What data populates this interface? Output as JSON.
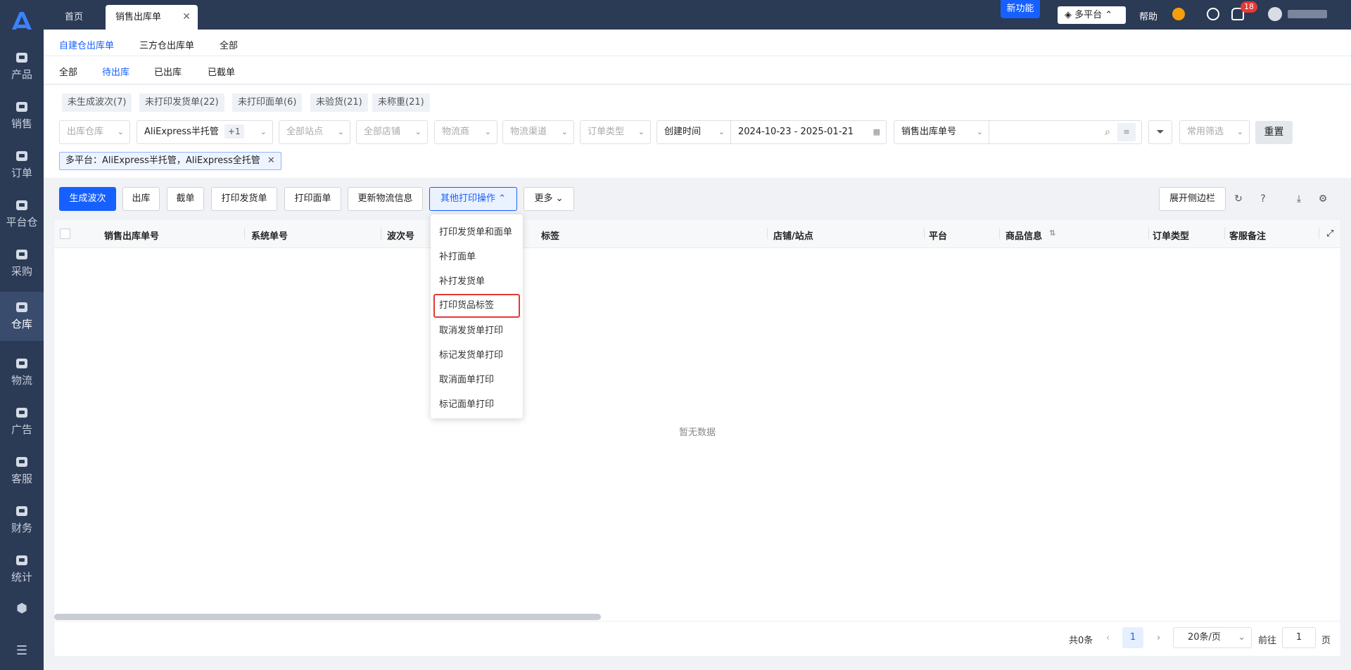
{
  "sidebar": {
    "logo": "A",
    "items": [
      {
        "label": "产品",
        "icon": "bag-icon"
      },
      {
        "label": "销售",
        "icon": "sell-icon"
      },
      {
        "label": "订单",
        "icon": "order-icon"
      },
      {
        "label": "平台仓",
        "icon": "platform-warehouse-icon"
      },
      {
        "label": "采购",
        "icon": "cart-icon"
      },
      {
        "label": "仓库",
        "icon": "warehouse-icon"
      },
      {
        "label": "物流",
        "icon": "truck-icon"
      },
      {
        "label": "广告",
        "icon": "ad-icon"
      },
      {
        "label": "客服",
        "icon": "mail-icon"
      },
      {
        "label": "财务",
        "icon": "yen-icon"
      },
      {
        "label": "统计",
        "icon": "pie-icon"
      }
    ],
    "active": "仓库"
  },
  "topbar": {
    "tabs": [
      {
        "label": "首页"
      },
      {
        "label": "销售出库单"
      }
    ],
    "new_feature": "新功能",
    "platform": "多平台",
    "help": "帮助",
    "notif_count": "18"
  },
  "subtabs": [
    "自建仓出库单",
    "三方仓出库单",
    "全部"
  ],
  "status_tabs": [
    "全部",
    "待出库",
    "已出库",
    "已截单"
  ],
  "chips": [
    "未生成波次(7)",
    "未打印发货单(22)",
    "未打印面单(6)",
    "未验货(21)",
    "未称重(21)"
  ],
  "filters": {
    "warehouse": "出库仓库",
    "platform_value": "AliExpress半托管",
    "platform_more": "+1",
    "site": "全部站点",
    "shop": "全部店铺",
    "carrier": "物流商",
    "channel": "物流渠道",
    "order_type": "订单类型",
    "time_type": "创建时间",
    "date_range": "2024-10-23  -  2025-01-21",
    "search_field": "销售出库单号",
    "common_filter": "常用筛选",
    "reset": "重置",
    "active_tag": "多平台：AliExpress半托管，AliExpress全托管"
  },
  "toolbar": {
    "generate_wave": "生成波次",
    "outbound": "出库",
    "cut_order": "截单",
    "print_invoice": "打印发货单",
    "print_label": "打印面单",
    "update_logistics": "更新物流信息",
    "other_print": "其他打印操作",
    "more": "更多",
    "expand_sidebar": "展开侧边栏"
  },
  "dropdown_items": [
    "打印发货单和面单",
    "补打面单",
    "补打发货单",
    "打印货品标签",
    "取消发货单打印",
    "标记发货单打印",
    "取消面单打印",
    "标记面单打印"
  ],
  "table": {
    "columns": [
      "销售出库单号",
      "系统单号",
      "波次号",
      "标签",
      "店铺/站点",
      "平台",
      "商品信息",
      "订单类型",
      "客服备注"
    ],
    "empty_text": "暂无数据"
  },
  "pagination": {
    "total": "共0条",
    "current_page": "1",
    "page_size": "20条/页",
    "goto_prefix": "前往",
    "goto_value": "1",
    "goto_suffix": "页"
  },
  "colors": {
    "accent": "#1660ff",
    "sidebar": "#2b3a55",
    "highlight": "#e53935"
  }
}
